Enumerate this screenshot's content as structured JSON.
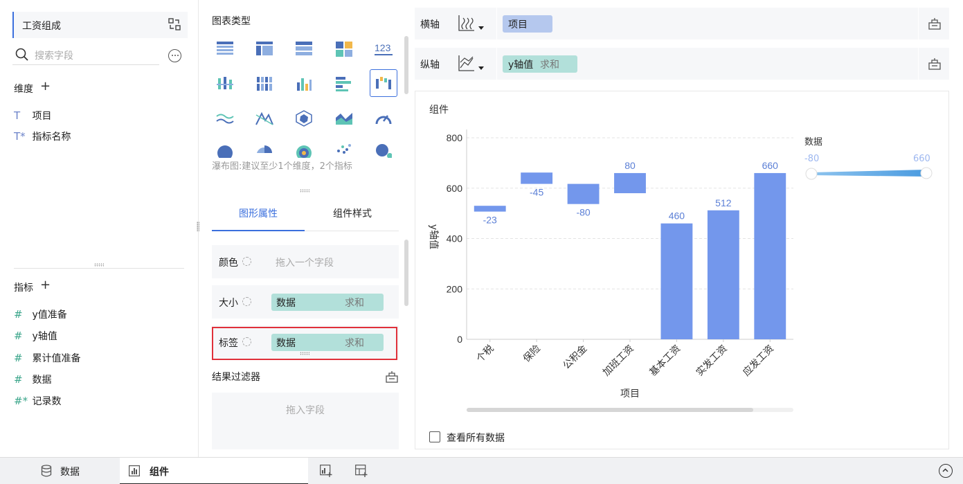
{
  "left": {
    "table_name": "工资组成",
    "search_placeholder": "搜索字段",
    "dimension_title": "维度",
    "dimensions": [
      {
        "label": "项目",
        "icon": "T"
      },
      {
        "label": "指标名称",
        "icon": "T*"
      }
    ],
    "measure_title": "指标",
    "measures": [
      {
        "label": "y值准备",
        "icon": "#"
      },
      {
        "label": "y轴值",
        "icon": "#"
      },
      {
        "label": "累计值准备",
        "icon": "#"
      },
      {
        "label": "数据",
        "icon": "#"
      },
      {
        "label": "记录数",
        "icon": "#*"
      }
    ]
  },
  "middle": {
    "chart_type_title": "图表类型",
    "hint": "瀑布图:建议至少1个维度，2个指标",
    "tabs": [
      "图形属性",
      "组件样式"
    ],
    "props": {
      "color_label": "颜色",
      "color_placeholder": "拖入一个字段",
      "size_label": "大小",
      "size_field": "数据",
      "size_agg": "求和",
      "label_label": "标签",
      "label_field": "数据",
      "label_agg": "求和"
    },
    "filter_title": "结果过滤器",
    "filter_placeholder": "拖入字段"
  },
  "axes": {
    "x_label": "横轴",
    "x_field": "项目",
    "y_label": "纵轴",
    "y_field": "y轴值",
    "y_agg": "求和"
  },
  "card": {
    "title": "组件",
    "show_all_label": "查看所有数据",
    "legend_title": "数据",
    "legend_min": "-80",
    "legend_max": "660"
  },
  "colors": {
    "accent": "#3b6fdd",
    "bar": "#7397ec",
    "label": "#5b7fd6",
    "pill_green": "#b2e0da",
    "pill_blue": "#b5c8ee",
    "highlight": "#e0303a"
  },
  "chart_data": {
    "type": "bar",
    "subtype": "waterfall",
    "categories": [
      "个税",
      "保险",
      "公积金",
      "加班工资",
      "基本工资",
      "实发工资",
      "应发工资"
    ],
    "values": [
      -23,
      -45,
      -80,
      80,
      460,
      512,
      660
    ],
    "labels": [
      "-23",
      "-45",
      "-80",
      "80",
      "460",
      "512",
      "660"
    ],
    "ranges": [
      [
        530,
        507
      ],
      [
        662,
        617
      ],
      [
        617,
        537
      ],
      [
        580,
        660
      ],
      [
        0,
        460
      ],
      [
        0,
        512
      ],
      [
        0,
        660
      ]
    ],
    "xlabel": "项目",
    "ylabel": "y轴值",
    "yticks": [
      "800",
      "600",
      "400",
      "200",
      "0"
    ],
    "ylim": [
      0,
      800
    ],
    "grid": true,
    "legend": "top-right"
  },
  "bottom": {
    "tab_data": "数据",
    "tab_component": "组件"
  }
}
